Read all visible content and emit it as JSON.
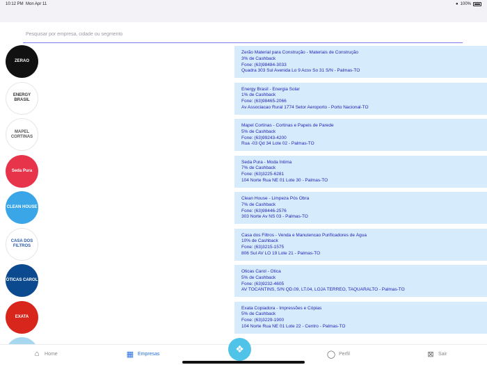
{
  "status": {
    "time": "10:12 PM",
    "date": "Mon Apr 11",
    "battery": "100%"
  },
  "search": {
    "placeholder": "Pesquisar por empresa, cidade ou segmento"
  },
  "companies": [
    {
      "line1": "Zerão Material para Construção  - Materiais de Construção",
      "line2": "3% de Cashback",
      "line3": "Fone: (63)98484-3033",
      "line4": "Quadra 303 Sul Avenida Lo 9 Acsv So 31 S/N - Palmas-TO",
      "logo_text": "ZERAO",
      "logo_color": "#111111",
      "logo_text_color": "#ffffff"
    },
    {
      "line1": "Energy Brasil  - Energia Solar",
      "line2": "1% de Cashback",
      "line3": "Fone: (63)98465-2066",
      "line4": "Av Associacao Rural 1774 Setor Aeroporto - Porto Nacional-TO",
      "logo_text": "ENERGY BRASIL",
      "logo_color": "#ffffff",
      "logo_text_color": "#333333"
    },
    {
      "line1": "Mapel Cortinas  - Cortinas e Papeis de Parede",
      "line2": "5% de Cashback",
      "line3": "Fone: (63)99243-4200",
      "line4": "Rua -03 Qd 34 Lote 02 - Palmas-TO",
      "logo_text": "MAPEL CORTINAS",
      "logo_color": "#ffffff",
      "logo_text_color": "#555555"
    },
    {
      "line1": "Seda Pura  - Moda Íntima",
      "line2": "7% de Cashback",
      "line3": "Fone: (63)3225-6281",
      "line4": "104 Norte Rua NE 01 Lote 30 - Palmas-TO",
      "logo_text": "Seda Pura",
      "logo_color": "#e8344a",
      "logo_text_color": "#ffffff"
    },
    {
      "line1": "Clean House  - Limpeza Pós Obra",
      "line2": "7% de Cashback",
      "line3": "Fone: (63)98446-2576",
      "line4": "303 Norte Av NS 03 - Palmas-TO",
      "logo_text": "CLEAN HOUSE",
      "logo_color": "#3aa6e8",
      "logo_text_color": "#ffffff"
    },
    {
      "line1": "Casa dos Filtros  - Venda e Manutencao Purificadores de Água",
      "line2": "10% de Cashback",
      "line3": "Fone: (63)3215-1575",
      "line4": "806 Sul AV LO 19 Lote 21 - Palmas-TO",
      "logo_text": "CASA DOS FILTROS",
      "logo_color": "#ffffff",
      "logo_text_color": "#2a5aa8"
    },
    {
      "line1": "Óticas Carol  - Ótica",
      "line2": "5% de Cashback",
      "line3": "Fone: (63)9232-4605",
      "line4": "AV TOCANTINS, S/N QD.09, LT.04, LOJA TERREO,  TAQUARALTO - Palmas-TO",
      "logo_text": "ÓTICAS CAROL",
      "logo_color": "#0b4a8f",
      "logo_text_color": "#ffffff"
    },
    {
      "line1": "Exata Copiadora  - Impressões e Cópias",
      "line2": "5% de Cashback",
      "line3": "Fone: (63)3229-1900",
      "line4": "104 Norte Rua NE 01 Lote 22 - Centro - Palmas-TO",
      "logo_text": "EXATA",
      "logo_color": "#d9261c",
      "logo_text_color": "#ffffff"
    },
    {
      "line1": "",
      "line2": "",
      "line3": "",
      "line4": "",
      "logo_text": "",
      "logo_color": "#a8d8f0",
      "logo_text_color": "#ffffff"
    }
  ],
  "tabs": {
    "home": "Home",
    "empresas": "Empresas",
    "perfil": "Perfil",
    "sair": "Sair"
  },
  "accent": "#2a6fe0"
}
